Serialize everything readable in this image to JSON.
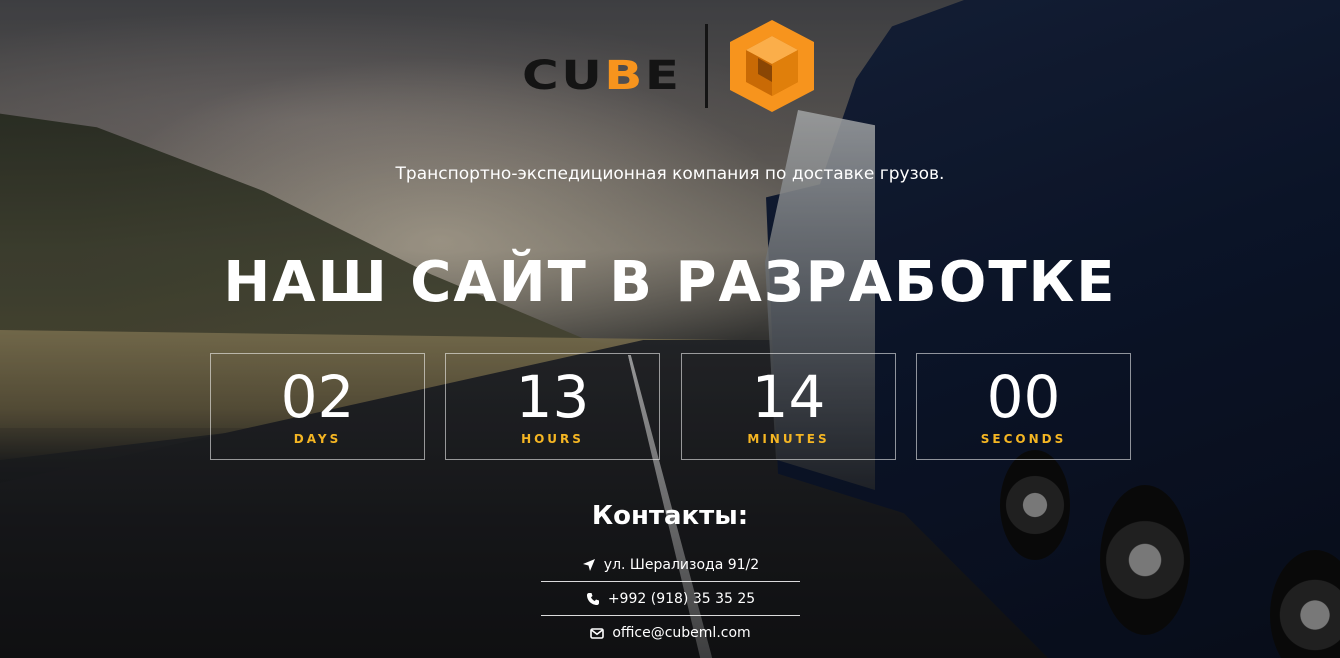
{
  "logo": {
    "text_part1": "CU",
    "text_part2": "B",
    "text_part3": "E",
    "brand_color": "#f7941d",
    "dark_color": "#141414"
  },
  "tagline": "Транспортно-экспедиционная компания по доставке грузов.",
  "heading": "НАШ САЙТ В РАЗРАБОТКЕ",
  "countdown": {
    "label_color": "#f5b623",
    "items": [
      {
        "value": "02",
        "label": "DAYS"
      },
      {
        "value": "13",
        "label": "HOURS"
      },
      {
        "value": "14",
        "label": "MINUTES"
      },
      {
        "value": "00",
        "label": "SECONDS"
      }
    ]
  },
  "contacts": {
    "title": "Контакты:",
    "items": [
      {
        "icon": "location-arrow-icon",
        "text": "ул. Шерализода 91/2"
      },
      {
        "icon": "phone-icon",
        "text": "+992 (918) 35 35 25"
      },
      {
        "icon": "envelope-icon",
        "text": "office@cubeml.com"
      }
    ]
  }
}
